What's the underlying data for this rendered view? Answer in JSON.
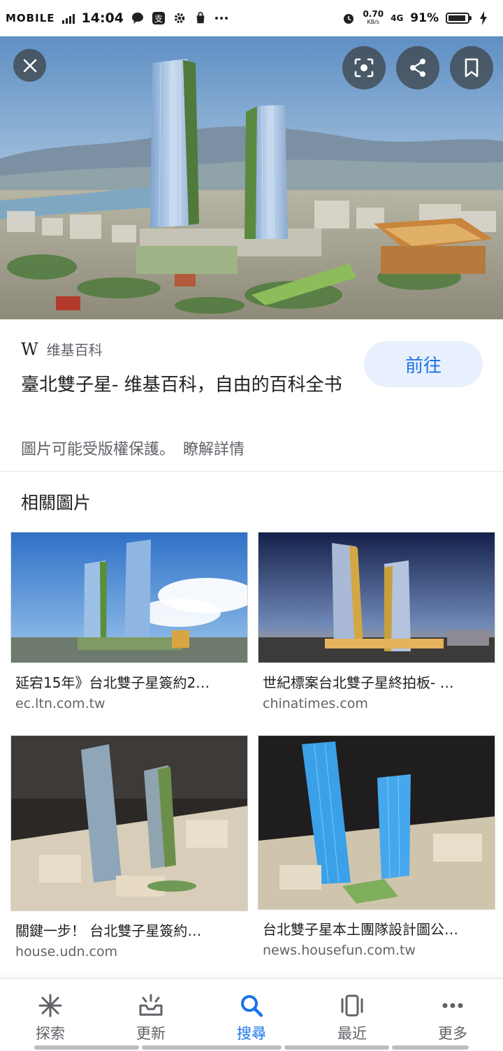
{
  "status_bar": {
    "carrier": "MOBILE",
    "time": "14:04",
    "speed_value": "0.70",
    "speed_unit": "KB/s",
    "network": "4G",
    "battery": "91%",
    "battery_level": 0.91
  },
  "hero": {
    "close_icon": "close-icon",
    "actions": [
      "lens-icon",
      "share-icon",
      "bookmark-icon"
    ]
  },
  "result": {
    "source_logo": "W",
    "source_name": "维基百科",
    "title": "臺北雙子星- 维基百科，自由的百科全书",
    "visit_label": "前往",
    "copyright_text": "圖片可能受版權保護。",
    "learn_more": "瞭解詳情"
  },
  "related": {
    "heading": "相關圖片",
    "items": [
      {
        "title": "延宕15年》台北雙子星簽約2…",
        "domain": "ec.ltn.com.tw"
      },
      {
        "title": "世紀標案台北雙子星終拍板- …",
        "domain": "chinatimes.com"
      },
      {
        "title": "關鍵一步！ 台北雙子星簽約…",
        "domain": "house.udn.com"
      },
      {
        "title": "台北雙子星本土團隊設計圖公…",
        "domain": "news.housefun.com.tw"
      }
    ]
  },
  "bottom_nav": {
    "items": [
      {
        "label": "探索",
        "icon": "asterisk-icon"
      },
      {
        "label": "更新",
        "icon": "updates-icon"
      },
      {
        "label": "搜尋",
        "icon": "search-icon"
      },
      {
        "label": "最近",
        "icon": "recent-icon"
      },
      {
        "label": "更多",
        "icon": "more-icon"
      }
    ],
    "active_index": 2
  },
  "colors": {
    "accent": "#1a73e8",
    "visit_button_bg": "#e8f0fe",
    "secondary_text": "#5f6368"
  }
}
